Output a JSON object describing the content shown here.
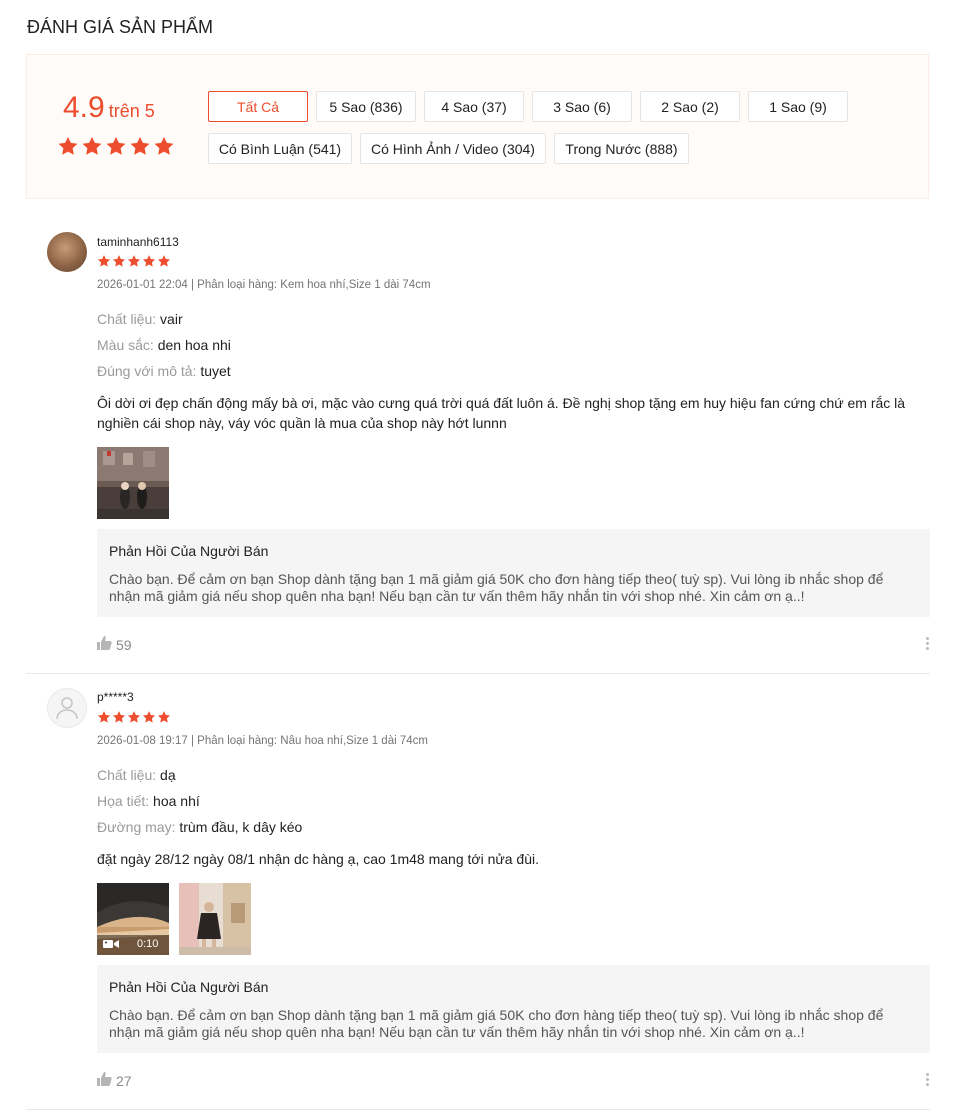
{
  "section_title": "ĐÁNH GIÁ SẢN PHẨM",
  "summary": {
    "rating": "4.9",
    "rating_suffix": "trên 5",
    "stars": 5,
    "filters_row1": [
      "Tất Cả",
      "5 Sao (836)",
      "4 Sao (37)",
      "3 Sao (6)",
      "2 Sao (2)",
      "1 Sao (9)"
    ],
    "filters_row2": [
      "Có Bình Luận (541)",
      "Có Hình Ảnh / Video (304)",
      "Trong Nước (888)"
    ],
    "active_filter": "Tất Cả"
  },
  "reviews": [
    {
      "username": "taminhanh6113",
      "stars": 5,
      "meta": "2026-01-01 22:04 | Phân loại hàng: Kem hoa nhí,Size 1 dài 74cm",
      "attributes": [
        {
          "key": "Chất liệu:",
          "value": "vair"
        },
        {
          "key": "Màu sắc:",
          "value": "den hoa nhi"
        },
        {
          "key": "Đúng với mô tả:",
          "value": "tuyet"
        }
      ],
      "comment": "Ôi dời ơi đẹp chấn động mấy bà ơi, mặc vào cưng quá trời quá đất luôn á. Đề nghị shop tặng em huy hiệu fan cứng chứ em rắc là nghiền cái shop này, váy vóc quần là mua của shop này hớt lunnn",
      "reply_title": "Phản Hồi Của Người Bán",
      "reply": "Chào bạn. Để cảm ơn bạn Shop dành tặng bạn 1 mã giảm giá 50K cho đơn hàng tiếp theo( tuỳ sp). Vui lòng ib nhắc shop để nhận mã giảm giá nếu shop quên nha bạn! Nếu bạn cần tư vấn thêm hãy nhắn tin với shop nhé. Xin cảm ơn ạ..!",
      "likes": "59"
    },
    {
      "username": "p*****3",
      "stars": 5,
      "meta": "2026-01-08 19:17 | Phân loại hàng: Nâu hoa nhí,Size 1 dài 74cm",
      "attributes": [
        {
          "key": "Chất liệu:",
          "value": "dạ"
        },
        {
          "key": "Họa tiết:",
          "value": "hoa nhí"
        },
        {
          "key": "Đường may:",
          "value": "trùm đầu, k dây kéo"
        }
      ],
      "comment": "đặt ngày 28/12 ngày 08/1 nhận dc hàng ạ, cao 1m48 mang tới nửa đùi.",
      "video_duration": "0:10",
      "reply_title": "Phản Hồi Của Người Bán",
      "reply": "Chào bạn. Để cảm ơn bạn Shop dành tặng bạn 1 mã giảm giá 50K cho đơn hàng tiếp theo( tuỳ sp). Vui lòng ib nhắc shop để nhận mã giảm giá nếu shop quên nha bạn! Nếu bạn cần tư vấn thêm hãy nhắn tin với shop nhé. Xin cảm ơn ạ..!",
      "likes": "27"
    }
  ],
  "colors": {
    "accent": "#ee4d2d",
    "summary_bg": "#fffbf8",
    "reply_bg": "#f5f5f5"
  },
  "icons": [
    "star-icon",
    "thumb-up-icon",
    "more-vertical-icon",
    "video-camera-icon",
    "default-avatar-icon"
  ]
}
